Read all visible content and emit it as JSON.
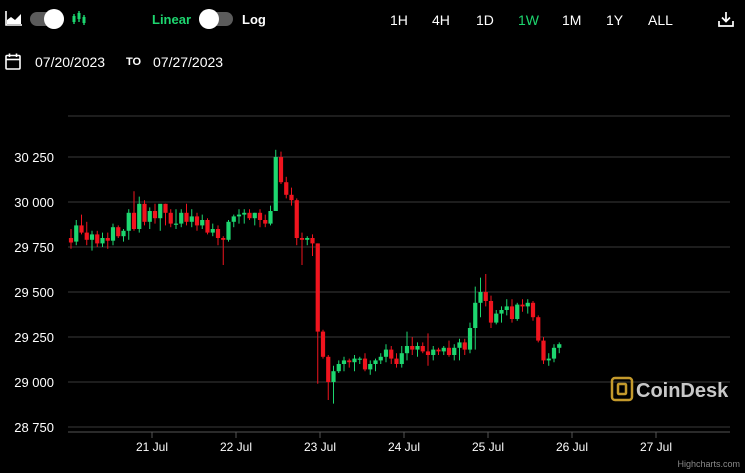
{
  "toolbar": {
    "chart_type_icon": "area-chart-icon",
    "candles_icon": "candlestick-icon",
    "scale_linear": "Linear",
    "scale_log": "Log",
    "download_icon": "download-icon",
    "ranges": [
      "1H",
      "4H",
      "1D",
      "1W",
      "1M",
      "1Y",
      "ALL"
    ],
    "active_range": "1W"
  },
  "date_range": {
    "icon": "calendar-icon",
    "start": "07/20/2023",
    "to_label": "TO",
    "end": "07/27/2023"
  },
  "colors": {
    "up": "#1dd66f",
    "down": "#f0141e",
    "accent": "#1dd66f",
    "grid": "#3a3a3a",
    "background": "#000000"
  },
  "watermark": {
    "text": "CoinDesk",
    "credit": "Highcharts.com"
  },
  "chart_data": {
    "type": "candlestick",
    "title": "",
    "xlabel": "",
    "ylabel": "",
    "ylim": [
      28750,
      30250
    ],
    "y_ticks": [
      28750,
      29000,
      29250,
      29500,
      29750,
      30000,
      30250
    ],
    "y_tick_labels": [
      "28 750",
      "29 000",
      "29 250",
      "29 500",
      "29 750",
      "30 000",
      "30 250"
    ],
    "x_tick_labels": [
      "21 Jul",
      "22 Jul",
      "23 Jul",
      "24 Jul",
      "25 Jul",
      "26 Jul",
      "27 Jul"
    ],
    "grid": true,
    "start_day": 20.0,
    "step_days": 0.0625,
    "candles": [
      [
        29800,
        29850,
        29740,
        29775
      ],
      [
        29780,
        29900,
        29760,
        29870
      ],
      [
        29870,
        29930,
        29820,
        29830
      ],
      [
        29830,
        29890,
        29760,
        29790
      ],
      [
        29790,
        29840,
        29730,
        29820
      ],
      [
        29820,
        29840,
        29750,
        29770
      ],
      [
        29770,
        29830,
        29750,
        29800
      ],
      [
        29800,
        29830,
        29740,
        29785
      ],
      [
        29785,
        29880,
        29760,
        29860
      ],
      [
        29860,
        29870,
        29800,
        29810
      ],
      [
        29810,
        29850,
        29780,
        29840
      ],
      [
        29840,
        29960,
        29790,
        29940
      ],
      [
        29940,
        30060,
        29840,
        29850
      ],
      [
        29850,
        30030,
        29830,
        29990
      ],
      [
        29990,
        30010,
        29870,
        29890
      ],
      [
        29890,
        29970,
        29850,
        29950
      ],
      [
        29950,
        29990,
        29880,
        29910
      ],
      [
        29910,
        29970,
        29840,
        29990
      ],
      [
        29990,
        29990,
        29870,
        29940
      ],
      [
        29940,
        29960,
        29860,
        29880
      ],
      [
        29880,
        29960,
        29850,
        29880
      ],
      [
        29880,
        29960,
        29860,
        29940
      ],
      [
        29940,
        29990,
        29870,
        29890
      ],
      [
        29890,
        29960,
        29860,
        29920
      ],
      [
        29920,
        29940,
        29840,
        29870
      ],
      [
        29870,
        29930,
        29850,
        29900
      ],
      [
        29900,
        29910,
        29820,
        29830
      ],
      [
        29830,
        29880,
        29810,
        29850
      ],
      [
        29850,
        29870,
        29760,
        29800
      ],
      [
        29800,
        29810,
        29650,
        29790
      ],
      [
        29790,
        29900,
        29780,
        29890
      ],
      [
        29890,
        29930,
        29860,
        29920
      ],
      [
        29920,
        29960,
        29880,
        29930
      ],
      [
        29930,
        29960,
        29880,
        29940
      ],
      [
        29940,
        29960,
        29900,
        29910
      ],
      [
        29910,
        29940,
        29870,
        29940
      ],
      [
        29940,
        29960,
        29860,
        29900
      ],
      [
        29900,
        29930,
        29860,
        29880
      ],
      [
        29880,
        29980,
        29870,
        29950
      ],
      [
        29950,
        30290,
        29950,
        30250
      ],
      [
        30250,
        30280,
        30100,
        30110
      ],
      [
        30110,
        30140,
        30020,
        30040
      ],
      [
        30040,
        30080,
        29980,
        30010
      ],
      [
        30010,
        30020,
        29760,
        29800
      ],
      [
        29800,
        29830,
        29650,
        29790
      ],
      [
        29790,
        29810,
        29760,
        29800
      ],
      [
        29800,
        29820,
        29700,
        29770
      ],
      [
        29770,
        29770,
        28990,
        29280
      ],
      [
        29280,
        29290,
        29130,
        29140
      ],
      [
        29140,
        29150,
        28900,
        29000
      ],
      [
        29000,
        29090,
        28880,
        29060
      ],
      [
        29060,
        29120,
        29050,
        29100
      ],
      [
        29100,
        29140,
        29060,
        29120
      ],
      [
        29120,
        29130,
        29080,
        29110
      ],
      [
        29110,
        29150,
        29060,
        29130
      ],
      [
        29130,
        29140,
        29100,
        29130
      ],
      [
        29130,
        29160,
        29060,
        29070
      ],
      [
        29070,
        29120,
        29040,
        29100
      ],
      [
        29100,
        29130,
        29060,
        29120
      ],
      [
        29120,
        29160,
        29100,
        29140
      ],
      [
        29140,
        29210,
        29110,
        29180
      ],
      [
        29180,
        29200,
        29100,
        29130
      ],
      [
        29130,
        29160,
        29080,
        29100
      ],
      [
        29100,
        29200,
        29080,
        29160
      ],
      [
        29160,
        29280,
        29120,
        29200
      ],
      [
        29200,
        29250,
        29150,
        29180
      ],
      [
        29180,
        29220,
        29140,
        29200
      ],
      [
        29200,
        29220,
        29160,
        29170
      ],
      [
        29170,
        29270,
        29090,
        29150
      ],
      [
        29150,
        29200,
        29120,
        29180
      ],
      [
        29180,
        29190,
        29150,
        29170
      ],
      [
        29170,
        29200,
        29150,
        29190
      ],
      [
        29190,
        29230,
        29140,
        29150
      ],
      [
        29150,
        29210,
        29120,
        29190
      ],
      [
        29190,
        29240,
        29120,
        29220
      ],
      [
        29220,
        29240,
        29150,
        29180
      ],
      [
        29180,
        29330,
        29160,
        29300
      ],
      [
        29300,
        29530,
        29180,
        29440
      ],
      [
        29440,
        29580,
        29360,
        29500
      ],
      [
        29500,
        29600,
        29420,
        29450
      ],
      [
        29450,
        29480,
        29300,
        29330
      ],
      [
        29330,
        29400,
        29320,
        29380
      ],
      [
        29380,
        29420,
        29330,
        29400
      ],
      [
        29400,
        29460,
        29370,
        29420
      ],
      [
        29420,
        29460,
        29330,
        29350
      ],
      [
        29350,
        29440,
        29340,
        29430
      ],
      [
        29430,
        29460,
        29390,
        29420
      ],
      [
        29420,
        29460,
        29380,
        29440
      ],
      [
        29440,
        29450,
        29340,
        29360
      ],
      [
        29360,
        29370,
        29220,
        29230
      ],
      [
        29230,
        29250,
        29100,
        29120
      ],
      [
        29120,
        29160,
        29090,
        29130
      ],
      [
        29130,
        29210,
        29110,
        29190
      ],
      [
        29190,
        29220,
        29160,
        29210
      ]
    ]
  }
}
